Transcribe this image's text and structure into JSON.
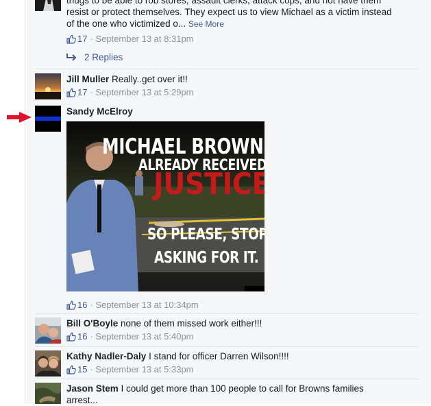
{
  "comments": {
    "c1": {
      "text_lines": [
        "thugs to be able to rob stores, assault clerks, attack cops, and not have them",
        "resist or protect themselves. They expect us to view Michael as a victim instead",
        "of the one who victimized o..."
      ],
      "see_more": "See More",
      "like_count": "17",
      "timestamp": "· September 13 at 8:31pm",
      "replies_label": "2 Replies"
    },
    "c2": {
      "author": "Jill Muller",
      "text": "Really..get over it!!",
      "like_count": "17",
      "timestamp": "· September 13 at 5:29pm"
    },
    "c3": {
      "author": "Sandy McElroy",
      "image_text": {
        "line1": "MICHAEL BROWN",
        "line2": "ALREADY RECEIVED",
        "line3": "JUSTICE",
        "line4": "SO PLEASE, STOP",
        "line5": "ASKING FOR IT."
      },
      "like_count": "16",
      "timestamp": "· September 13 at 10:34pm"
    },
    "c4": {
      "author": "Bill O'Boyle",
      "text": "none of them missed work either!!!",
      "like_count": "16",
      "timestamp": "· September 13 at 5:40pm"
    },
    "c5": {
      "author": "Kathy Nadler-Daly",
      "text": "I stand for officer Darren Wilson!!!!",
      "like_count": "15",
      "timestamp": "· September 13 at 5:33pm"
    },
    "c6": {
      "author": "Jason Stem",
      "text": "I could get more than 100 people to call for Browns families",
      "text_line2": "arrest..."
    }
  },
  "colors": {
    "link_blue": "#3b5998",
    "meta_gray": "#8c909a",
    "annotation_arrow": "#e3122b",
    "panel_bg": "#f6f7f9"
  },
  "icons": {
    "like": "thumbs-up-icon",
    "reply": "reply-arrow-icon",
    "annotation": "red-arrow-icon"
  }
}
